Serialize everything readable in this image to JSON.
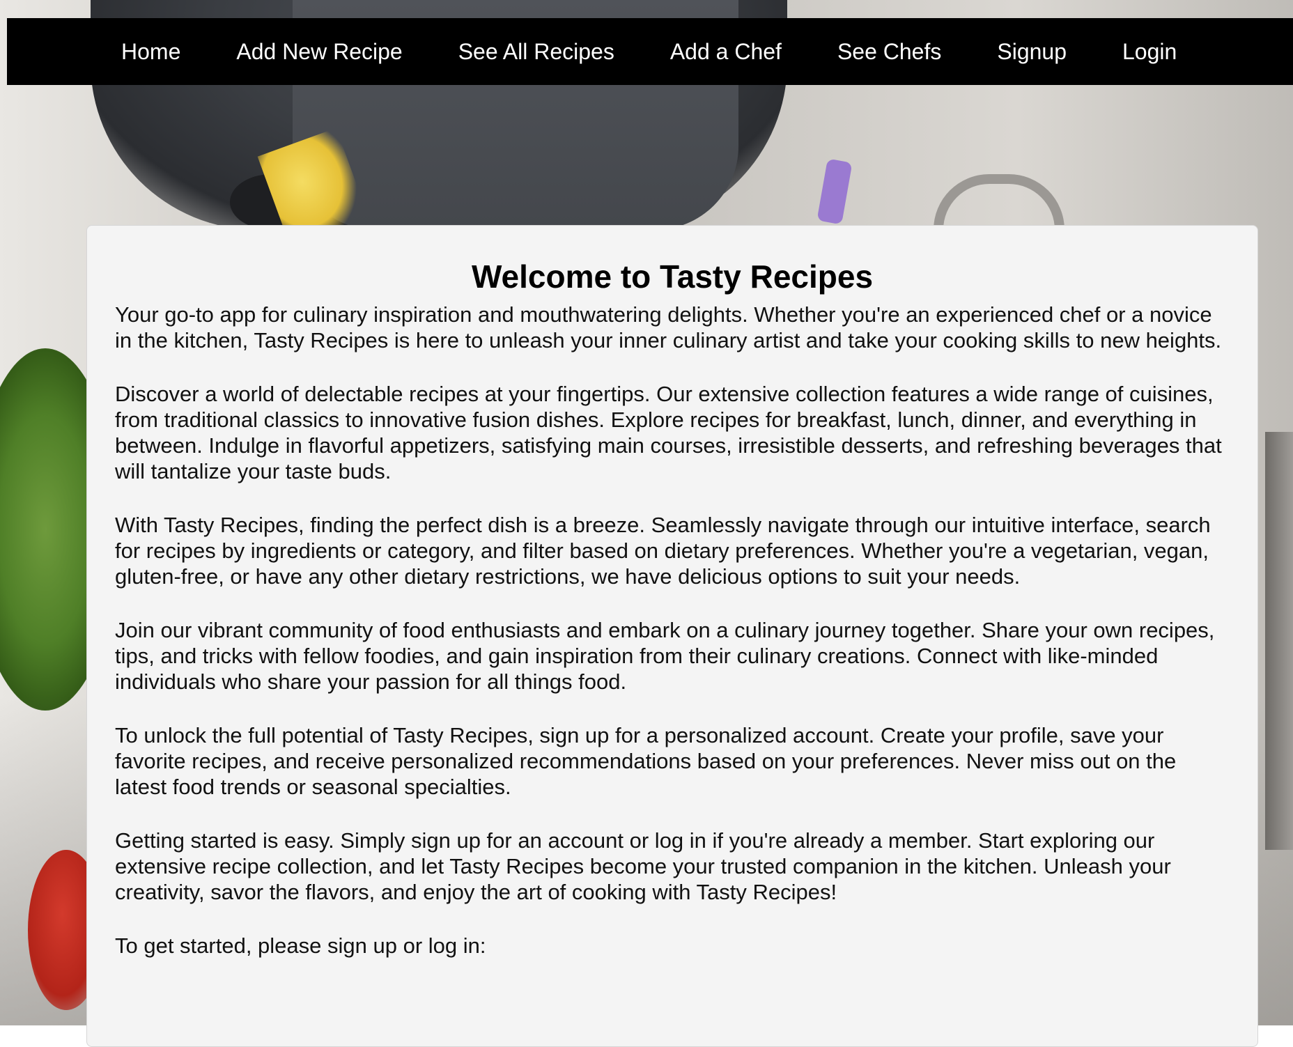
{
  "nav": {
    "links": [
      "Home",
      "Add New Recipe",
      "See All Recipes",
      "Add a Chef",
      "See Chefs",
      "Signup",
      "Login"
    ]
  },
  "main": {
    "title": "Welcome to Tasty Recipes",
    "paragraphs": [
      "Your go-to app for culinary inspiration and mouthwatering delights. Whether you're an experienced chef or a novice in the kitchen, Tasty Recipes is here to unleash your inner culinary artist and take your cooking skills to new heights.",
      "Discover a world of delectable recipes at your fingertips. Our extensive collection features a wide range of cuisines, from traditional classics to innovative fusion dishes. Explore recipes for breakfast, lunch, dinner, and everything in between. Indulge in flavorful appetizers, satisfying main courses, irresistible desserts, and refreshing beverages that will tantalize your taste buds.",
      "With Tasty Recipes, finding the perfect dish is a breeze. Seamlessly navigate through our intuitive interface, search for recipes by ingredients or category, and filter based on dietary preferences. Whether you're a vegetarian, vegan, gluten-free, or have any other dietary restrictions, we have delicious options to suit your needs.",
      "Join our vibrant community of food enthusiasts and embark on a culinary journey together. Share your own recipes, tips, and tricks with fellow foodies, and gain inspiration from their culinary creations. Connect with like-minded individuals who share your passion for all things food.",
      "To unlock the full potential of Tasty Recipes, sign up for a personalized account. Create your profile, save your favorite recipes, and receive personalized recommendations based on your preferences. Never miss out on the latest food trends or seasonal specialties.",
      "Getting started is easy. Simply sign up for an account or log in if you're already a member. Start exploring our extensive recipe collection, and let Tasty Recipes become your trusted companion in the kitchen. Unleash your creativity, savor the flavors, and enjoy the art of cooking with Tasty Recipes!",
      "To get started, please sign up or log in:"
    ]
  }
}
